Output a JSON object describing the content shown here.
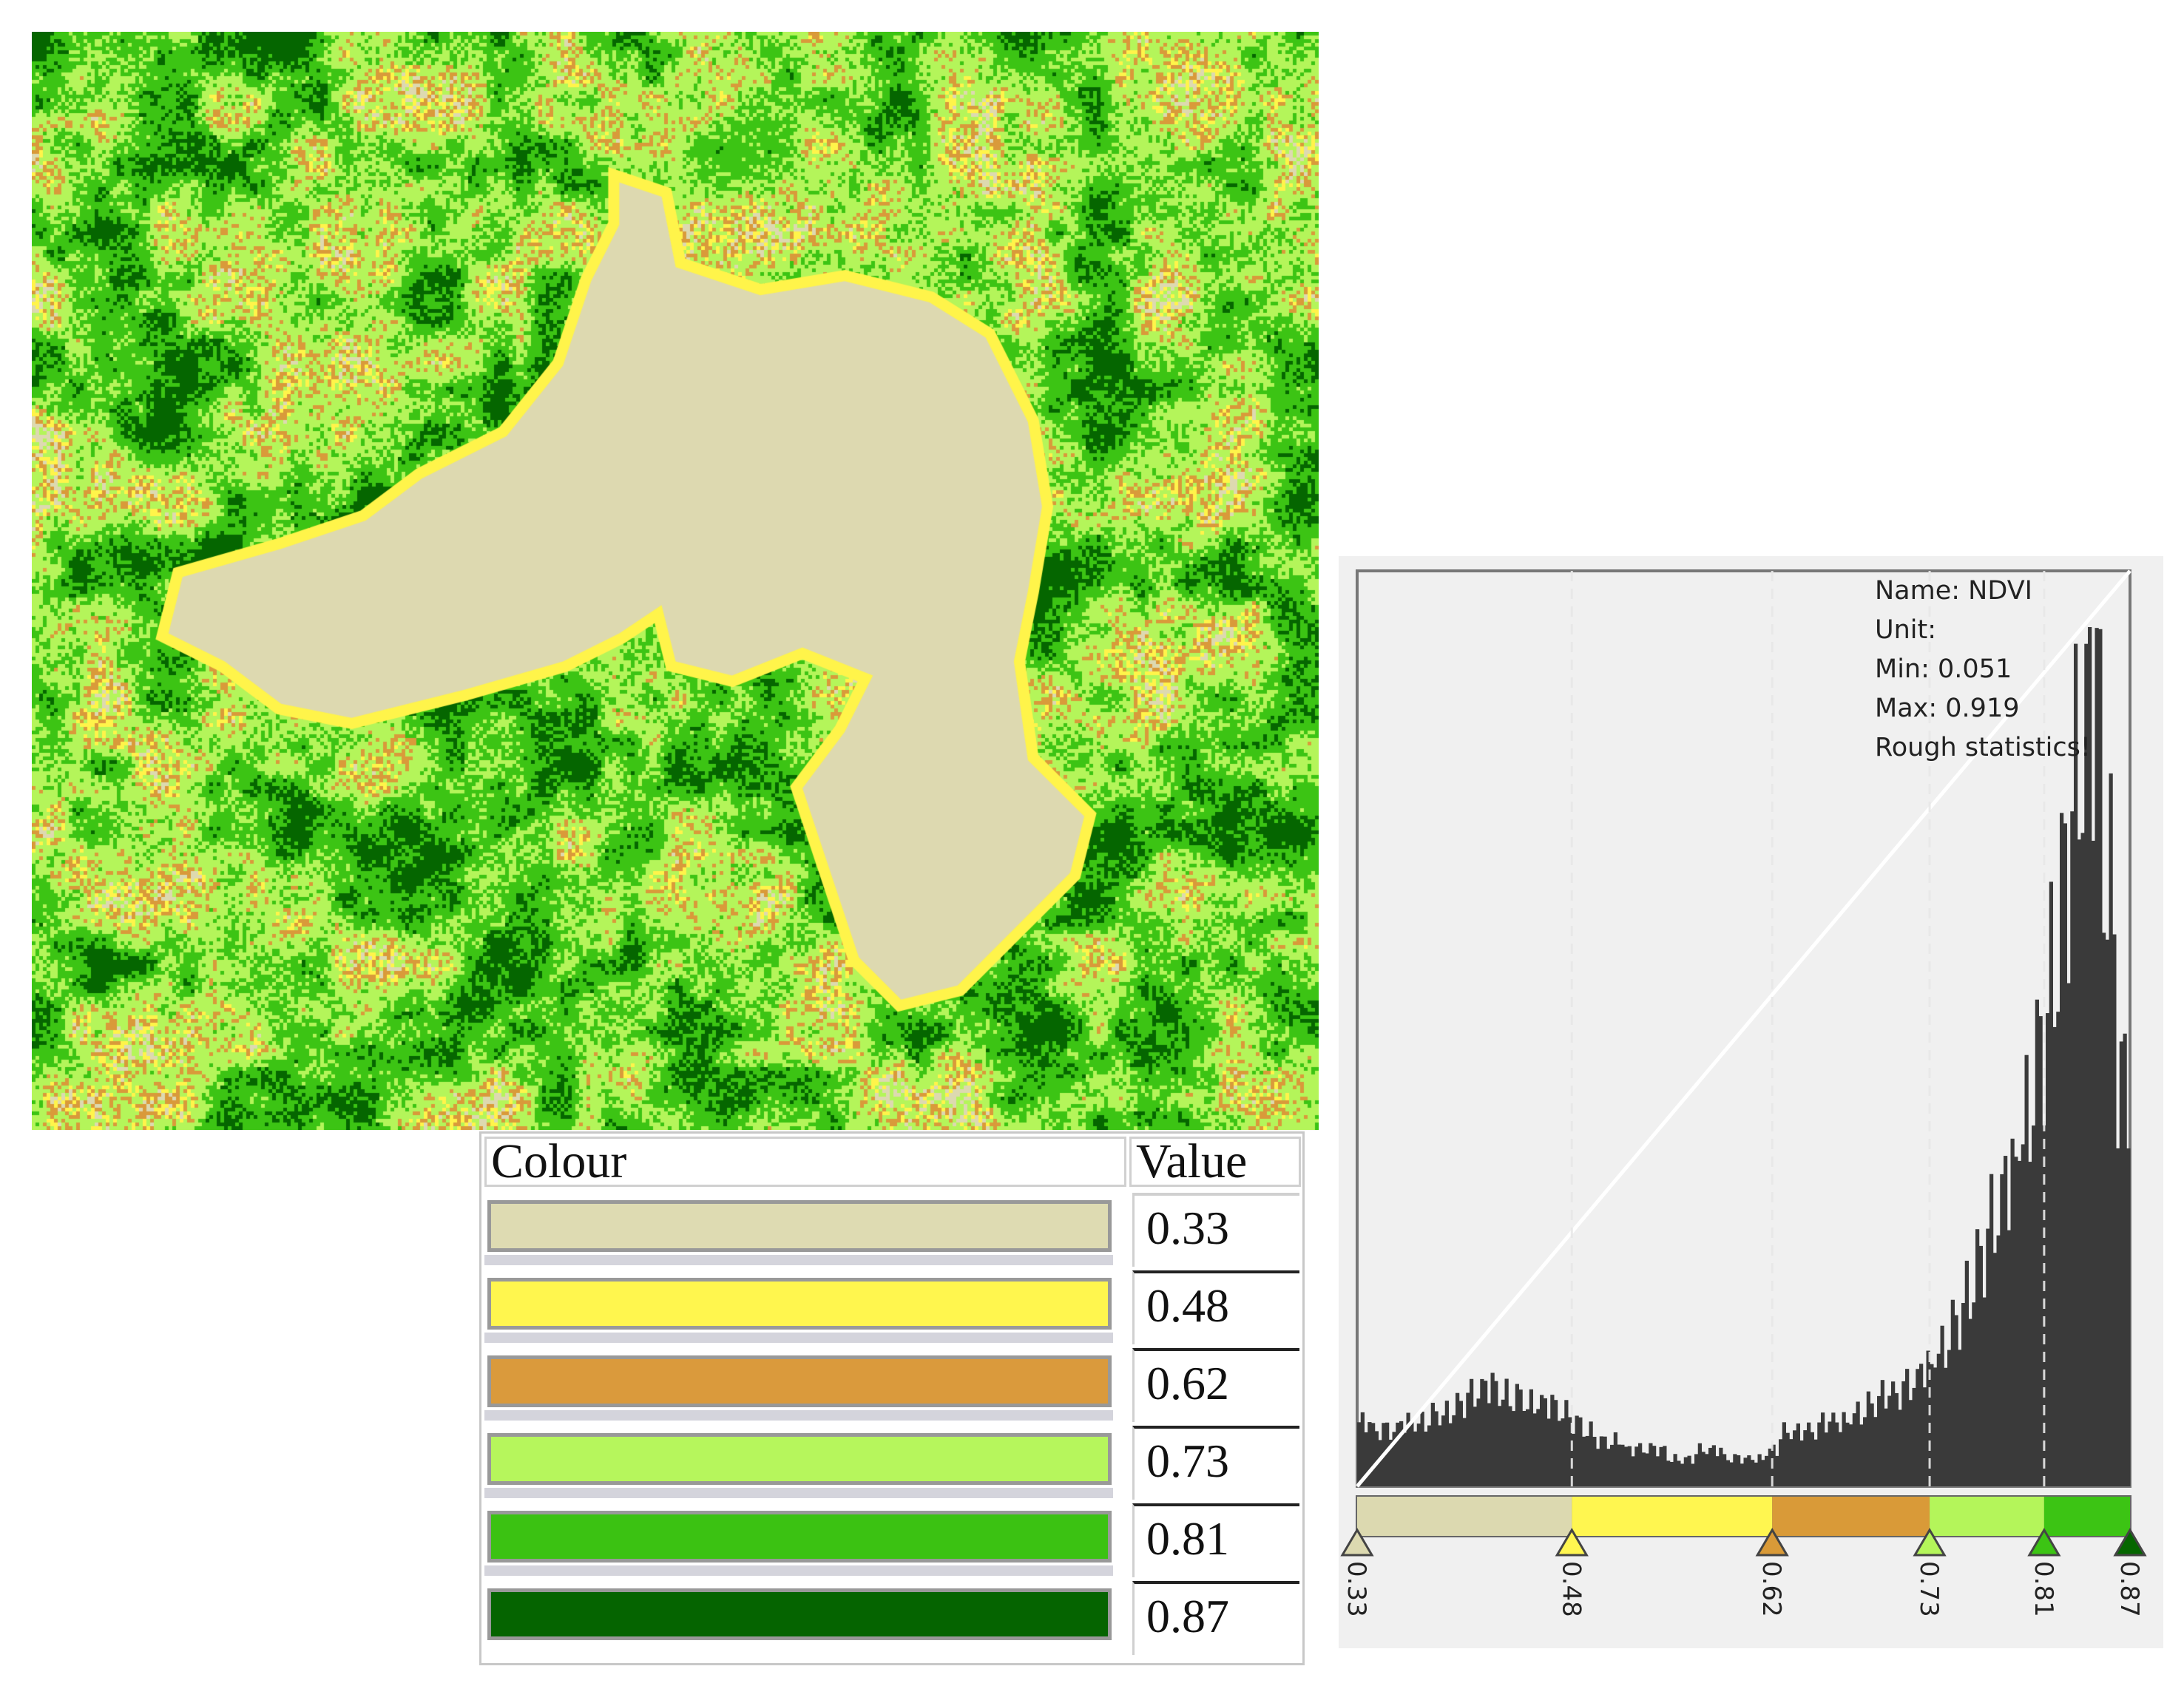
{
  "map": {
    "class_colors": [
      "#ddd9b0",
      "#fff44a",
      "#d99a3a",
      "#b4f55a",
      "#3cc414",
      "#056600"
    ]
  },
  "legend": {
    "header_colour": "Colour",
    "header_value": "Value",
    "rows": [
      {
        "color": "#dedbb2",
        "value": "0.33"
      },
      {
        "color": "#fff64e",
        "value": "0.48"
      },
      {
        "color": "#da9a3c",
        "value": "0.62"
      },
      {
        "color": "#b6f65c",
        "value": "0.73"
      },
      {
        "color": "#3bc212",
        "value": "0.81"
      },
      {
        "color": "#056400",
        "value": "0.87"
      }
    ]
  },
  "chart_data": {
    "type": "bar",
    "title": "",
    "xlabel": "",
    "ylabel": "",
    "xlim": [
      0.33,
      0.87
    ],
    "ylim": [
      0,
      1
    ],
    "grid": false,
    "stats": {
      "name": "Name: NDVI",
      "unit": "Unit:",
      "min": "Min: 0.051",
      "max": "Max: 0.919",
      "warning": "Rough statistics!"
    },
    "x": [
      0.33,
      0.34,
      0.35,
      0.36,
      0.37,
      0.38,
      0.39,
      0.4,
      0.41,
      0.42,
      0.43,
      0.44,
      0.45,
      0.46,
      0.47,
      0.48,
      0.49,
      0.5,
      0.51,
      0.52,
      0.53,
      0.54,
      0.55,
      0.56,
      0.57,
      0.58,
      0.59,
      0.6,
      0.61,
      0.62,
      0.63,
      0.64,
      0.65,
      0.66,
      0.67,
      0.68,
      0.69,
      0.7,
      0.71,
      0.72,
      0.73,
      0.74,
      0.75,
      0.76,
      0.77,
      0.78,
      0.79,
      0.8,
      0.81,
      0.82,
      0.83,
      0.84,
      0.85,
      0.86,
      0.87
    ],
    "values": [
      0.07,
      0.06,
      0.06,
      0.07,
      0.07,
      0.08,
      0.08,
      0.09,
      0.1,
      0.11,
      0.1,
      0.1,
      0.09,
      0.09,
      0.08,
      0.07,
      0.06,
      0.05,
      0.05,
      0.04,
      0.04,
      0.04,
      0.03,
      0.03,
      0.04,
      0.04,
      0.03,
      0.03,
      0.03,
      0.04,
      0.06,
      0.06,
      0.06,
      0.07,
      0.07,
      0.08,
      0.09,
      0.1,
      0.1,
      0.11,
      0.13,
      0.15,
      0.18,
      0.21,
      0.25,
      0.29,
      0.34,
      0.4,
      0.48,
      0.56,
      0.67,
      0.78,
      0.86,
      0.66,
      0.45
    ],
    "color_stops": [
      {
        "value": 0.33,
        "label": "0.33",
        "color": "#dcd9b0"
      },
      {
        "value": 0.48,
        "label": "0.48",
        "color": "#fff650"
      },
      {
        "value": 0.62,
        "label": "0.62",
        "color": "#d99a38"
      },
      {
        "value": 0.73,
        "label": "0.73",
        "color": "#b4f55a"
      },
      {
        "value": 0.81,
        "label": "0.81",
        "color": "#3cc414"
      },
      {
        "value": 0.87,
        "label": "0.87",
        "color": "#056600"
      }
    ],
    "bar_color": "#3a3a3a",
    "warning_color": "#a01a2a"
  }
}
